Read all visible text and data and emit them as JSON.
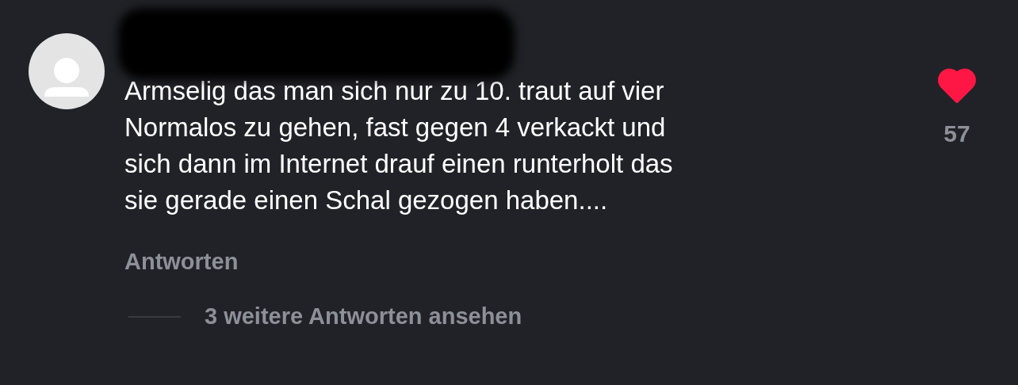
{
  "comment": {
    "author_redacted": true,
    "text_lines": [
      "Armselig das man sich nur zu 10. traut auf vier",
      "Normalos zu gehen, fast gegen 4 verkackt und",
      "sich dann im Internet drauf einen runterholt das",
      "sie gerade einen Schal gezogen haben...."
    ],
    "reply_label": "Antworten",
    "liked": true,
    "like_count": "57"
  },
  "more_replies": "3 weitere Antworten ansehen"
}
